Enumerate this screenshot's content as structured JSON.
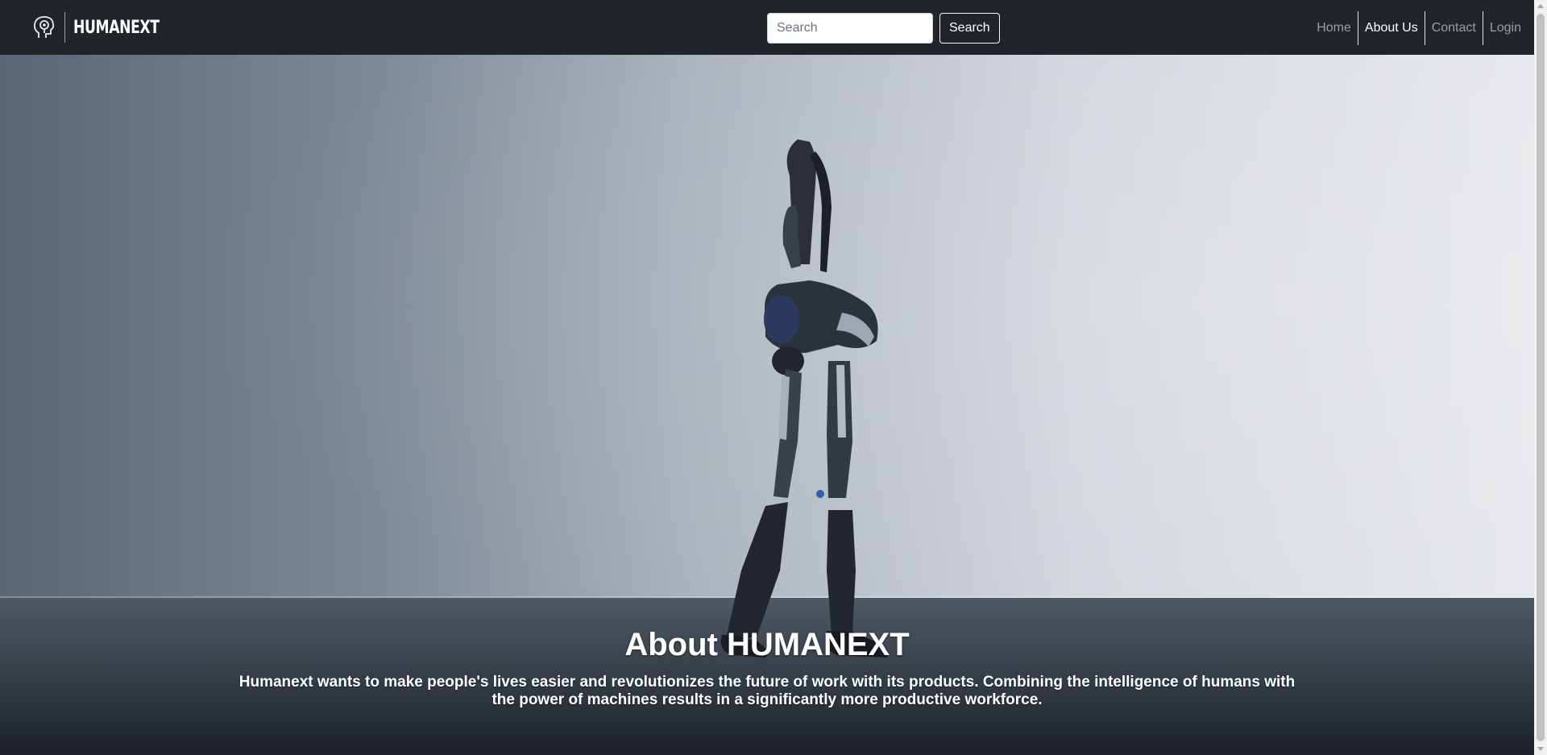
{
  "navbar": {
    "brand_name": "HUMANEXT",
    "brand_icon": "head-gear-icon",
    "search": {
      "placeholder": "Search",
      "value": "",
      "button_label": "Search"
    },
    "links": [
      {
        "label": "Home",
        "active": false
      },
      {
        "label": "About Us",
        "active": true
      },
      {
        "label": "Contact",
        "active": false
      },
      {
        "label": "Login",
        "active": false
      }
    ]
  },
  "hero": {
    "title": "About HUMANEXT",
    "description": "Humanext wants to make people's lives easier and revolutionizes the future of work with its products. Combining the intelligence of humans with the power of machines results in a significantly more productive workforce."
  },
  "colors": {
    "navbar_bg": "#212529",
    "text_white": "#ffffff",
    "nav_muted": "rgba(255,255,255,0.55)"
  }
}
